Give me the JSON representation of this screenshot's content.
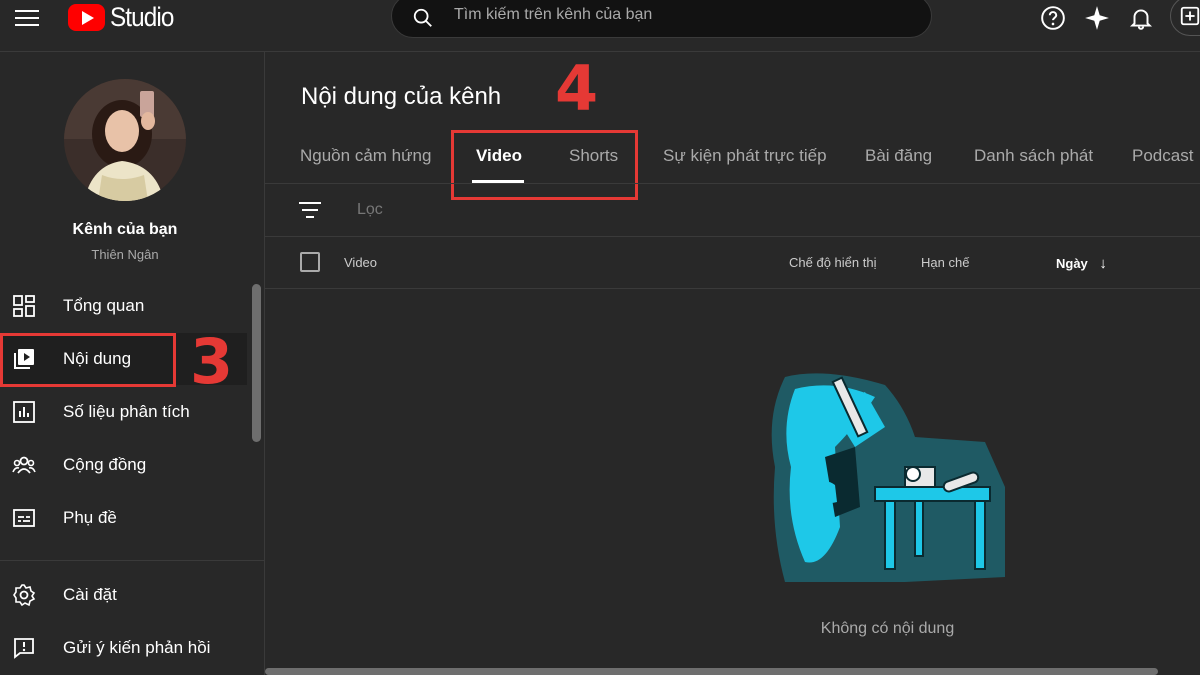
{
  "header": {
    "logo_text": "Studio",
    "search_placeholder": "Tìm kiếm trên kênh của bạn",
    "icons": [
      "menu-icon",
      "help-icon",
      "sparkle-icon",
      "bell-icon",
      "create-icon"
    ]
  },
  "channel": {
    "name": "Kênh của bạn",
    "handle": "Thiên Ngân"
  },
  "sidebar": {
    "items": [
      {
        "label": "Tổng quan",
        "icon": "dashboard-icon"
      },
      {
        "label": "Nội dung",
        "icon": "content-icon",
        "active": true
      },
      {
        "label": "Số liệu phân tích",
        "icon": "analytics-icon"
      },
      {
        "label": "Cộng đồng",
        "icon": "community-icon"
      },
      {
        "label": "Phụ đề",
        "icon": "subtitles-icon"
      }
    ],
    "bottom_items": [
      {
        "label": "Cài đặt",
        "icon": "settings-icon"
      },
      {
        "label": "Gửi ý kiến phản hồi",
        "icon": "feedback-icon"
      }
    ]
  },
  "annotations": {
    "step3": "3",
    "step4": "4",
    "color": "#e53935"
  },
  "main": {
    "title": "Nội dung của kênh",
    "tabs": [
      {
        "label": "Nguồn cảm hứng"
      },
      {
        "label": "Video",
        "active": true
      },
      {
        "label": "Shorts"
      },
      {
        "label": "Sự kiện phát trực tiếp"
      },
      {
        "label": "Bài đăng"
      },
      {
        "label": "Danh sách phát"
      },
      {
        "label": "Podcast"
      }
    ],
    "filter_placeholder": "Lọc",
    "columns": {
      "video": "Video",
      "visibility": "Chế độ hiển thị",
      "restrictions": "Hạn chế",
      "date": "Ngày"
    },
    "sort_arrow": "↓",
    "empty_text": "Không có nội dung"
  }
}
